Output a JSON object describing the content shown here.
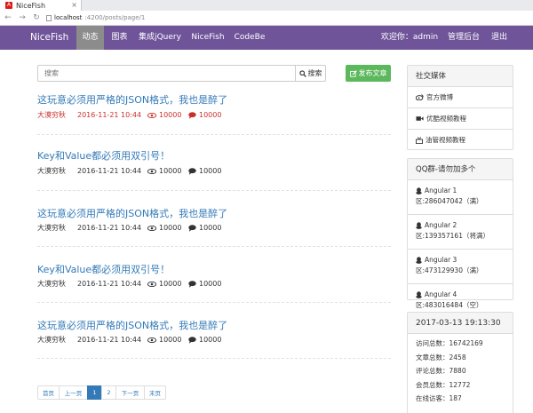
{
  "browser": {
    "tab_title": "NiceFish",
    "tab_close": "×",
    "url_host": "localhost",
    "url_path": ":4200/posts/page/1"
  },
  "navbar": {
    "brand": "NiceFish",
    "items": [
      {
        "label": "动态",
        "active": true
      },
      {
        "label": "图表",
        "active": false
      },
      {
        "label": "集成jQuery",
        "active": false
      },
      {
        "label": "NiceFish",
        "active": false
      },
      {
        "label": "CodeBe",
        "active": false
      }
    ],
    "welcome": "欢迎你：admin",
    "admin_link": "管理后台",
    "logout": "退出"
  },
  "search": {
    "placeholder": "搜索",
    "button_label": "搜索",
    "publish_label": "发布文章"
  },
  "posts": [
    {
      "title": "这玩意必须用严格的JSON格式，我也是醉了",
      "author": "大漠穷秋",
      "date": "2016-11-21 10:44",
      "views": "10000",
      "comments": "10000",
      "highlight": true
    },
    {
      "title": "Key和Value都必须用双引号！",
      "author": "大漠穷秋",
      "date": "2016-11-21 10:44",
      "views": "10000",
      "comments": "10000",
      "highlight": false
    },
    {
      "title": "这玩意必须用严格的JSON格式，我也是醉了",
      "author": "大漠穷秋",
      "date": "2016-11-21 10:44",
      "views": "10000",
      "comments": "10000",
      "highlight": false
    },
    {
      "title": "Key和Value都必须用双引号！",
      "author": "大漠穷秋",
      "date": "2016-11-21 10:44",
      "views": "10000",
      "comments": "10000",
      "highlight": false
    },
    {
      "title": "这玩意必须用严格的JSON格式，我也是醉了",
      "author": "大漠穷秋",
      "date": "2016-11-21 10:44",
      "views": "10000",
      "comments": "10000",
      "highlight": false
    }
  ],
  "pagination": {
    "first": "首页",
    "prev": "上一页",
    "pages": [
      "1",
      "2"
    ],
    "current": "1",
    "next": "下一页",
    "last": "末页"
  },
  "sidebar": {
    "social": {
      "title": "社交媒体",
      "items": [
        {
          "label": "官方微博",
          "icon": "weibo-icon"
        },
        {
          "label": "优酷视频教程",
          "icon": "video-camera-icon"
        },
        {
          "label": "油管视频教程",
          "icon": "youtube-icon"
        }
      ]
    },
    "qq": {
      "title": "QQ群-请勿加多个",
      "groups": [
        {
          "name": "Angular 1",
          "detail": "区:286047042（满）"
        },
        {
          "name": "Angular 2",
          "detail": "区:139357161（将满）"
        },
        {
          "name": "Angular 3",
          "detail": "区:473129930（满）"
        },
        {
          "name": "Angular 4",
          "detail": "区:483016484（空）"
        }
      ]
    },
    "stats": {
      "datetime": "2017-03-13 19:13:30",
      "lines": [
        "访问总数：16742169",
        "文章总数：2458",
        "评论总数：7880",
        "会员总数：12772",
        "在线访客：187"
      ]
    }
  },
  "colors": {
    "navbar_bg": "#6f5499",
    "nav_active_bg": "#8c8c8c",
    "link": "#337ab7",
    "publish_btn": "#5cb85c",
    "meta_highlight": "#c9302c"
  }
}
